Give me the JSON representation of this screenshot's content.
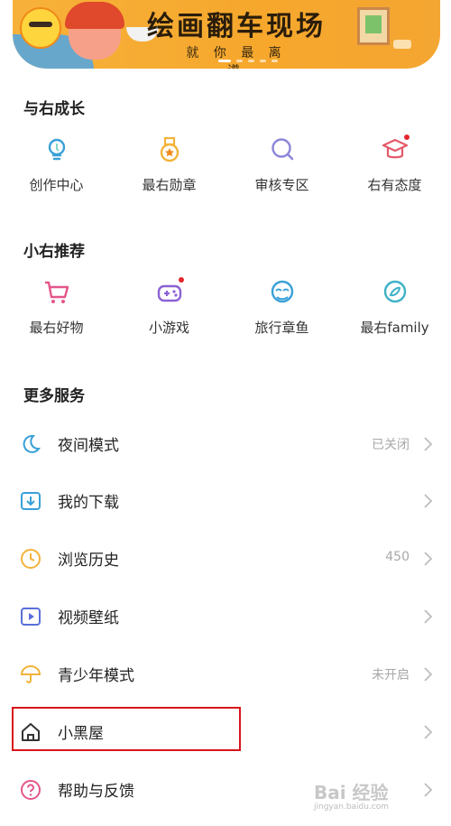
{
  "banner": {
    "title": "绘画翻车现场",
    "subtitle": "就 你 最 离 谱"
  },
  "sections": {
    "growth": {
      "title": "与右成长",
      "items": [
        {
          "label": "创作中心",
          "icon": "lightbulb-icon"
        },
        {
          "label": "最右勋章",
          "icon": "medal-icon"
        },
        {
          "label": "审核专区",
          "icon": "search-icon"
        },
        {
          "label": "右有态度",
          "icon": "graduation-cap-icon",
          "badge": true
        }
      ]
    },
    "recommend": {
      "title": "小右推荐",
      "items": [
        {
          "label": "最右好物",
          "icon": "shopping-cart-icon"
        },
        {
          "label": "小游戏",
          "icon": "gamepad-icon",
          "badge": true
        },
        {
          "label": "旅行章鱼",
          "icon": "octopus-icon"
        },
        {
          "label": "最右family",
          "icon": "family-icon"
        }
      ]
    },
    "services": {
      "title": "更多服务",
      "rows": [
        {
          "label": "夜间模式",
          "value": "已关闭",
          "icon": "moon-icon"
        },
        {
          "label": "我的下载",
          "value": "",
          "icon": "download-icon"
        },
        {
          "label": "浏览历史",
          "value": "450",
          "icon": "clock-icon"
        },
        {
          "label": "视频壁纸",
          "value": "",
          "icon": "video-play-icon"
        },
        {
          "label": "青少年模式",
          "value": "未开启",
          "icon": "umbrella-icon"
        },
        {
          "label": "小黑屋",
          "value": "",
          "icon": "house-icon"
        },
        {
          "label": "帮助与反馈",
          "value": "",
          "icon": "help-icon"
        }
      ]
    }
  },
  "watermark": {
    "text": "Bai 经验",
    "sub": "jingyan.baidu.com"
  },
  "colors": {
    "accent": "#3aa0d8",
    "badge": "#e4262c",
    "highlight": "#d8141b"
  }
}
